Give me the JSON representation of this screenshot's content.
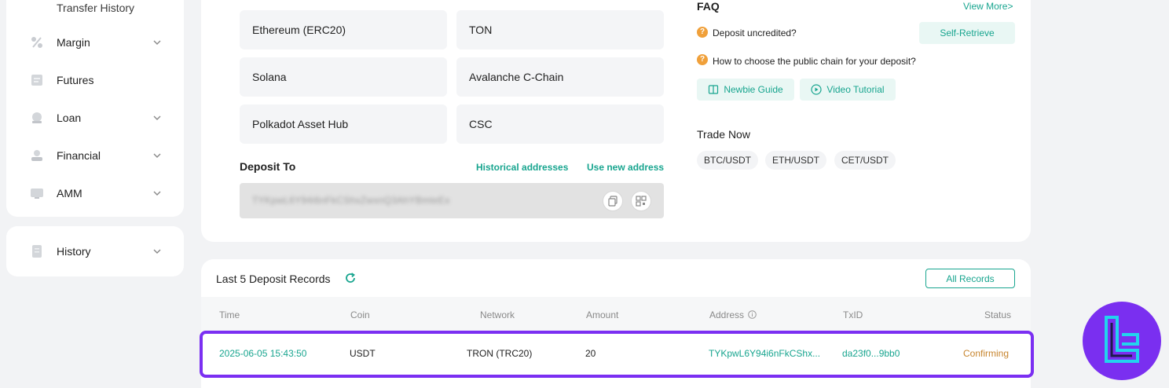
{
  "sidebar": {
    "transfer_history": "Transfer History",
    "items": [
      {
        "label": "Margin",
        "icon": "percent-icon"
      },
      {
        "label": "Futures",
        "icon": "futures-icon"
      },
      {
        "label": "Loan",
        "icon": "loan-icon"
      },
      {
        "label": "Financial",
        "icon": "financial-icon"
      },
      {
        "label": "AMM",
        "icon": "amm-icon"
      }
    ],
    "history": {
      "label": "History",
      "icon": "history-icon"
    }
  },
  "networks": [
    "Ethereum (ERC20)",
    "TON",
    "Solana",
    "Avalanche C-Chain",
    "Polkadot Asset Hub",
    "CSC"
  ],
  "deposit": {
    "label": "Deposit To",
    "historical_addresses": "Historical addresses",
    "use_new_address": "Use new address",
    "address_masked": "TYKpwL6Y94i6nFkCShxZwxnQ3AhYBmteEx"
  },
  "faq": {
    "title": "FAQ",
    "view_more": "View More>",
    "q1": "Deposit uncredited?",
    "q1_action": "Self-Retrieve",
    "q2": "How to choose the public chain for your deposit?",
    "newbie_guide": "Newbie Guide",
    "video_tutorial": "Video Tutorial"
  },
  "trade_now": {
    "title": "Trade Now",
    "pairs": [
      "BTC/USDT",
      "ETH/USDT",
      "CET/USDT"
    ]
  },
  "records": {
    "title": "Last 5 Deposit Records",
    "all_records": "All Records",
    "headers": [
      "Time",
      "Coin",
      "Network",
      "Amount",
      "Address",
      "TxID",
      "Status"
    ],
    "row": {
      "time": "2025-06-05 15:43:50",
      "coin": "USDT",
      "network": "TRON (TRC20)",
      "amount": "20",
      "address": "TYKpwL6Y94i6nFkCShx...",
      "txid": "da23f0...9bb0",
      "status": "Confirming"
    }
  },
  "colors": {
    "accent": "#18a58f",
    "status_pending": "#c7852e",
    "highlight": "#7b2ff2"
  }
}
